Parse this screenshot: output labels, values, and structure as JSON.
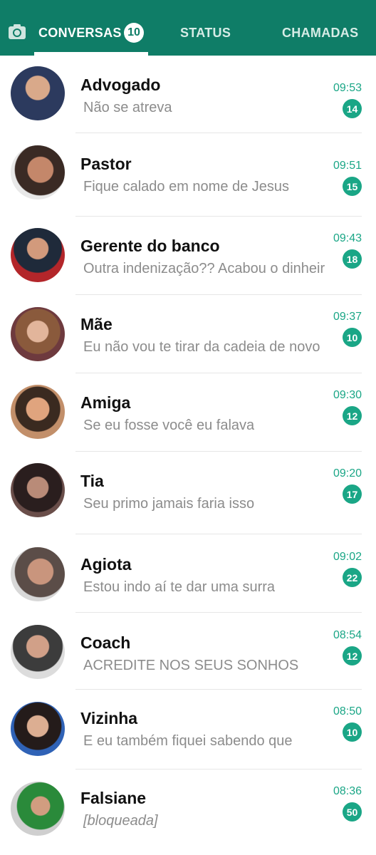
{
  "header": {
    "tabs": [
      {
        "label": "CONVERSAS",
        "badge": "10",
        "active": true
      },
      {
        "label": "STATUS"
      },
      {
        "label": "CHAMADAS"
      }
    ],
    "colors": {
      "bar": "#0f7d67",
      "accent": "#1aa686"
    }
  },
  "chats": [
    {
      "name": "Advogado",
      "preview": "Não se atreva",
      "time": "09:53",
      "unread": "14"
    },
    {
      "name": "Pastor",
      "preview": "Fique calado em nome de Jesus",
      "time": "09:51",
      "unread": "15"
    },
    {
      "name": "Gerente do banco",
      "preview": "Outra indenização?? Acabou o dinheir",
      "time": "09:43",
      "unread": "18"
    },
    {
      "name": "Mãe",
      "preview": "Eu não vou te tirar da cadeia de novo",
      "time": "09:37",
      "unread": "10"
    },
    {
      "name": "Amiga",
      "preview": "Se eu fosse você eu falava",
      "time": "09:30",
      "unread": "12"
    },
    {
      "name": "Tia",
      "preview": "Seu primo jamais faria isso",
      "time": "09:20",
      "unread": "17"
    },
    {
      "name": "Agiota",
      "preview": "Estou indo aí te dar uma surra",
      "time": "09:02",
      "unread": "22"
    },
    {
      "name": "Coach",
      "preview": "ACREDITE NOS SEUS SONHOS",
      "time": "08:54",
      "unread": "12"
    },
    {
      "name": "Vizinha",
      "preview": "E eu também fiquei sabendo que",
      "time": "08:50",
      "unread": "10"
    },
    {
      "name": "Falsiane",
      "preview": "[bloqueada]",
      "time": "08:36",
      "unread": "50"
    }
  ]
}
